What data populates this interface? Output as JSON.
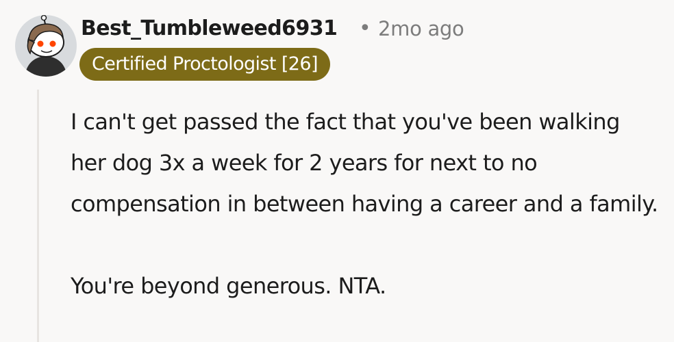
{
  "comment": {
    "avatar_icon": "snoo-avatar-icon",
    "username": "Best_Tumbleweed6931",
    "separator": "•",
    "timestamp": "2mo ago",
    "flair": "Certified Proctologist [26]",
    "flair_color": "#7d6b17",
    "paragraphs": [
      "I can't get passed the fact that you've been walking her dog 3x a week for 2 years for next to no compensation in between having a career and a family.",
      "You're beyond generous. NTA."
    ]
  }
}
